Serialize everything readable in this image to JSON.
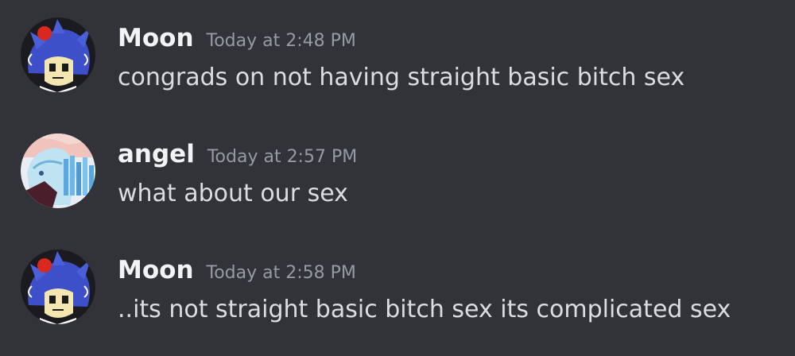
{
  "messages": [
    {
      "username": "Moon",
      "timestamp": "Today at 2:48 PM",
      "content": "congrads on not having straight basic bitch sex",
      "avatar_icon": "anime-character-blue-hair-avatar"
    },
    {
      "username": "angel",
      "timestamp": "Today at 2:57 PM",
      "content": "what about our sex",
      "avatar_icon": "anime-character-light-blue-avatar"
    },
    {
      "username": "Moon",
      "timestamp": "Today at 2:58 PM",
      "content": "..its not straight basic bitch sex its complicated sex",
      "avatar_icon": "anime-character-blue-hair-avatar"
    }
  ],
  "colors": {
    "background": "#313338",
    "username": "#f2f3f5",
    "timestamp": "#949ba4",
    "message_text": "#dbdee1"
  }
}
